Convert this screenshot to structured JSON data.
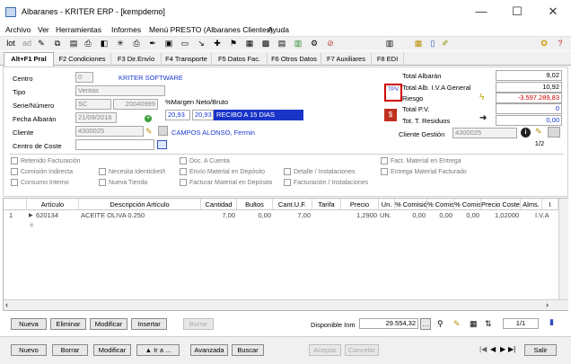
{
  "window": {
    "title": "Albaranes - KRITER ERP - [kempdemo]",
    "minimize": "—",
    "maximize": "☐",
    "close": "✕"
  },
  "menu": [
    "Archivo",
    "Ver",
    "Herramientas",
    "Informes",
    "Menú PRESTO (Albaranes Clientes)",
    "Ayuda"
  ],
  "tabs": [
    "Alt+F1 Pral",
    "F2 Condiciones",
    "F3 Dir.Envío",
    "F4 Transporte",
    "F5 Datos Fac.",
    "F6 Otros Datos",
    "F7 Auxiliares",
    "F8 EDI"
  ],
  "form": {
    "centro_label": "Centro",
    "centro_code": "0",
    "centro_name": "KRITER SOFTWARE",
    "tipo_label": "Tipo",
    "tipo_value": "Ventas",
    "serie_label": "Serie/Número",
    "serie_value": "SC",
    "numero_value": "20040999",
    "fecha_label": "Fecha Albarán",
    "fecha_value": "21/09/2016",
    "cliente_label": "Cliente",
    "cliente_code": "4300025",
    "cliente_name": "CAMPOS ALONSO, Fermin",
    "centro_coste_label": "Centro de Coste",
    "margen_label": "%Margen Neto/Bruto",
    "margen_neto": "20,93",
    "margen_bruto": "20,93",
    "forma_pago": "RECIBO A 15 DIAS",
    "tpv_label": "TPV",
    "total_albaran_label": "Total Albarán",
    "total_albaran": "9,02",
    "total_iva_label": "Total Alb. I.V.A General",
    "total_iva": "10,92",
    "riesgo_label": "Riesgo",
    "riesgo": "-3.597.289,83",
    "total_pv_label": "Total P.V.",
    "total_pv": "0",
    "residuos_label": "Tot. T. Residuos",
    "residuos": "0,00",
    "gestion_label": "Cliente Gestión",
    "gestion_value": "4300025",
    "page": "1/2"
  },
  "checks": [
    "Retenido Facturación",
    "Doc. A Cuenta",
    "Fact. Material en Entrega",
    "Comisión Indirecta",
    "Necesita Identicket/t",
    "Envío Material en Depósito",
    "Detalle / Instalaciones",
    "Entrega Material Facturado",
    "Consumo Interno",
    "Nueva Tienda",
    "Facturar Material en Depósito",
    "Facturación / Instalaciones"
  ],
  "grid": {
    "headers": [
      "Artículo",
      "Descripción Artículo",
      "Cantidad",
      "Bultos",
      "Cant.U.F.",
      "Tarifa",
      "Precio",
      "Un.",
      "% Comisió",
      "% Comis.",
      "% Comis.",
      "Precio Coste",
      "Alms.",
      "I"
    ],
    "row": {
      "num": "1",
      "articulo": "620134",
      "descripcion": "ACEITE OLIVA 0.250",
      "cantidad": "7,00",
      "bultos": "0,00",
      "cantuf": "7,00",
      "tarifa": "",
      "precio": "1,2900",
      "un": "UN.",
      "c1": "0,00",
      "c2": "0,00",
      "c3": "0,00",
      "coste": "1,0200",
      "alms": "0",
      "iva": "I.V.A"
    }
  },
  "linebar": {
    "nueva": "Nueva",
    "eliminar": "Eliminar",
    "modificar": "Modificar",
    "insertar": "Insertar",
    "borrar": "Borrar",
    "disponible_label": "Disponible Inm",
    "disponible": "29.554,32",
    "page": "1/1"
  },
  "statusbar": {
    "nuevo": "Nuevo",
    "borrar": "Borrar",
    "modificar": "Modificar",
    "ira": "▲ Ir a ...",
    "avanzada": "Avanzada",
    "buscar": "Buscar",
    "aceptar": "Aceptar",
    "cancelar": "Cancelar",
    "salir": "Salir"
  }
}
